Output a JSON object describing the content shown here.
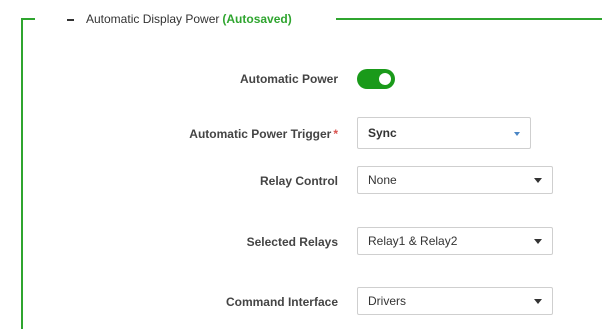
{
  "section": {
    "title": "Automatic Display Power",
    "status": "(Autosaved)",
    "collapse_icon": "minus-icon",
    "accent_color": "#2fa52f"
  },
  "fields": {
    "automatic_power": {
      "label": "Automatic Power",
      "enabled": true,
      "toggle_color": "#1a9a1a"
    },
    "trigger": {
      "label": "Automatic Power Trigger",
      "required_mark": "*",
      "value": "Sync"
    },
    "relay_control": {
      "label": "Relay Control",
      "value": "None"
    },
    "selected_relays": {
      "label": "Selected Relays",
      "value": "Relay1 & Relay2"
    },
    "command_interface": {
      "label": "Command Interface",
      "value": "Drivers"
    }
  }
}
